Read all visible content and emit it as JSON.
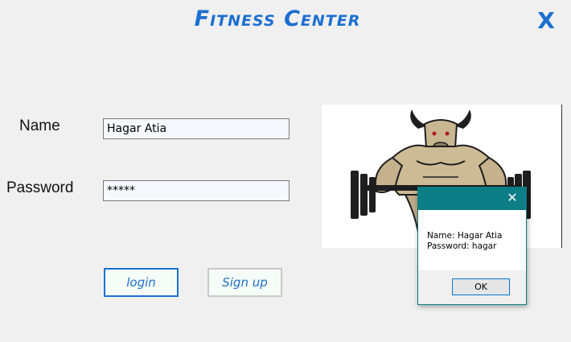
{
  "app": {
    "title": "Fitness Center",
    "close_label": "X"
  },
  "form": {
    "name_label": "Name",
    "name_value": "Hagar Atia",
    "password_label": "Password",
    "password_value": "*****"
  },
  "buttons": {
    "login_label": "login",
    "signup_label": "Sign up"
  },
  "image": {
    "description_icon": "bodybuilder-bull-icon"
  },
  "dialog": {
    "close_label": "✕",
    "message_name": "Name: Hagar Atia",
    "message_password": "Password: hagar",
    "ok_label": "OK"
  },
  "colors": {
    "accent": "#1c6fd0",
    "dialog_titlebar": "#0d7d86"
  }
}
